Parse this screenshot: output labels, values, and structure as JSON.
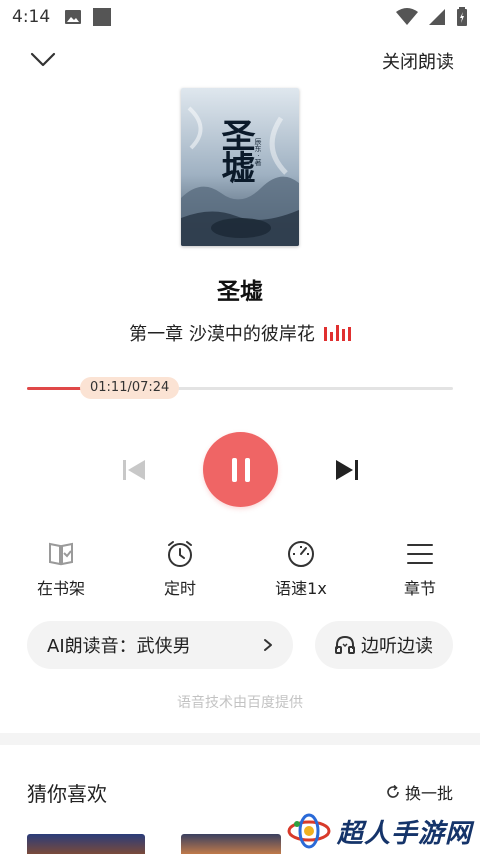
{
  "status_bar": {
    "time": "4:14"
  },
  "header": {
    "close_reading": "关闭朗读"
  },
  "book": {
    "cover_title": "圣墟",
    "cover_author": "辰东 · 著",
    "title": "圣墟",
    "chapter": "第一章 沙漠中的彼岸花"
  },
  "player": {
    "time_display": "01:11/07:24",
    "progress_fraction": 0.16
  },
  "functions": {
    "bookshelf": "在书架",
    "timer": "定时",
    "speed": "语速1x",
    "chapters": "章节"
  },
  "voice": {
    "label": "AI朗读音：武侠男"
  },
  "listen_read": {
    "label": "边听边读"
  },
  "tech_note": "语音技术由百度提供",
  "recommend": {
    "title": "猜你喜欢",
    "refresh": "换一批"
  },
  "watermark": {
    "text": "超人手游网"
  },
  "colors": {
    "accent": "#ef6565",
    "progress": "#e04848",
    "thumb_bg": "#fbe3d4"
  }
}
